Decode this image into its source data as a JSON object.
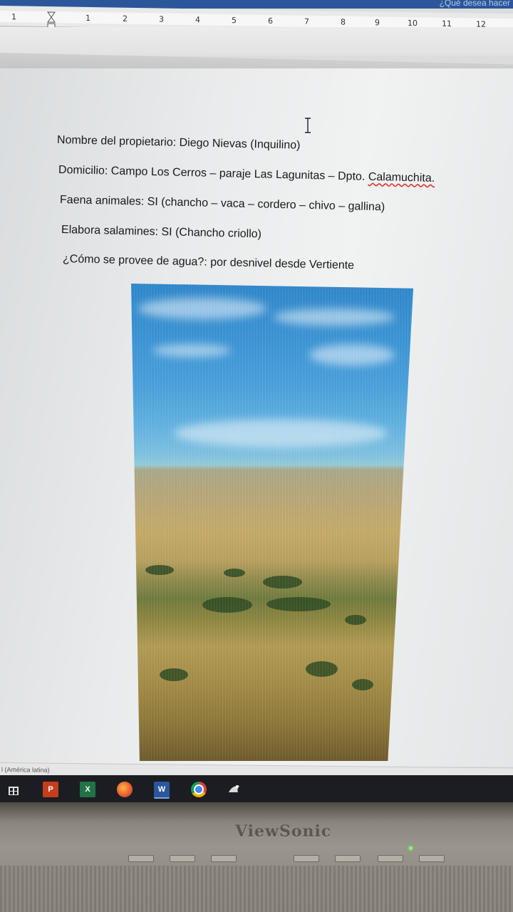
{
  "app": {
    "tell_me": "¿Qué desea hacer",
    "ruler_numbers": [
      "1",
      "1",
      "2",
      "3",
      "4",
      "5",
      "6",
      "7",
      "8",
      "9",
      "10",
      "11",
      "12"
    ]
  },
  "document": {
    "lines": [
      "Nombre del propietario: Diego Nievas (Inquilino)",
      "Domicilio: Campo Los Cerros – paraje Las Lagunitas – Dpto. ",
      "Faena animales: SI (chancho – vaca – cordero – chivo – gallina)",
      "Elabora salamines: SI (Chancho criollo)",
      "¿Cómo se provee de agua?: por desnivel desde Vertiente"
    ],
    "misspelled_word": "Calamuchita.",
    "image_alt": "Paisaje de sierras con pastizales"
  },
  "status_bar": {
    "language": "l (América latina)"
  },
  "taskbar": {
    "icons": [
      "windows-store-icon",
      "powerpoint-icon",
      "excel-icon",
      "firefox-icon",
      "word-icon",
      "chrome-icon",
      "app-icon"
    ]
  },
  "monitor": {
    "brand": "ViewSonic"
  },
  "colors": {
    "word_blue": "#2b579a",
    "taskbar": "#1c1d22",
    "powerpoint": "#c43e1c",
    "excel": "#217346",
    "word": "#2b579a"
  }
}
